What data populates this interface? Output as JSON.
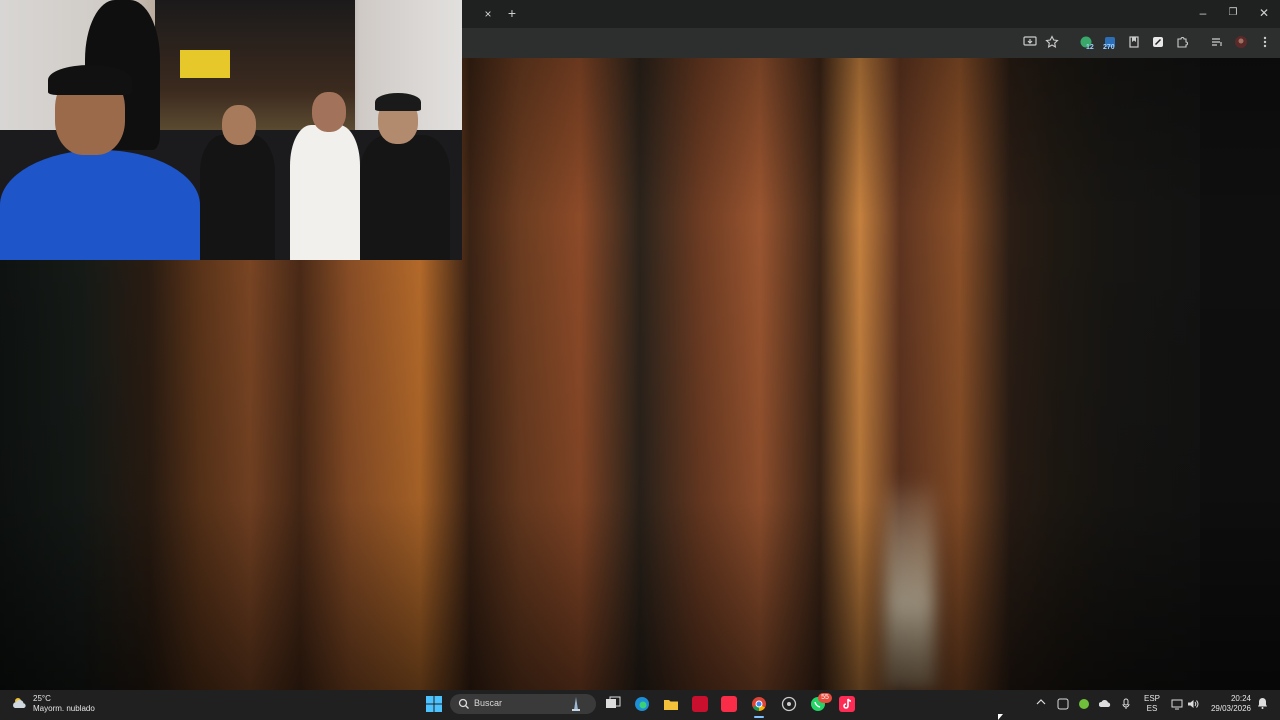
{
  "browser": {
    "close_tab_glyph": "×",
    "new_tab_glyph": "+",
    "window_controls": {
      "minimize": "–",
      "restore": "❐",
      "close": "✕"
    },
    "extensions": [
      {
        "icon": "shield-extension-icon",
        "badge": "12"
      },
      {
        "icon": "stats-extension-icon",
        "badge": "270"
      }
    ]
  },
  "taskbar": {
    "weather": {
      "temperature": "25°C",
      "condition": "Mayorm. nublado"
    },
    "search": {
      "placeholder": "Buscar"
    },
    "notification_badge": "55",
    "language": {
      "top": "ESP",
      "bottom": "ES"
    },
    "clock": {
      "time": "20:24",
      "date": "29/03/2026"
    }
  }
}
